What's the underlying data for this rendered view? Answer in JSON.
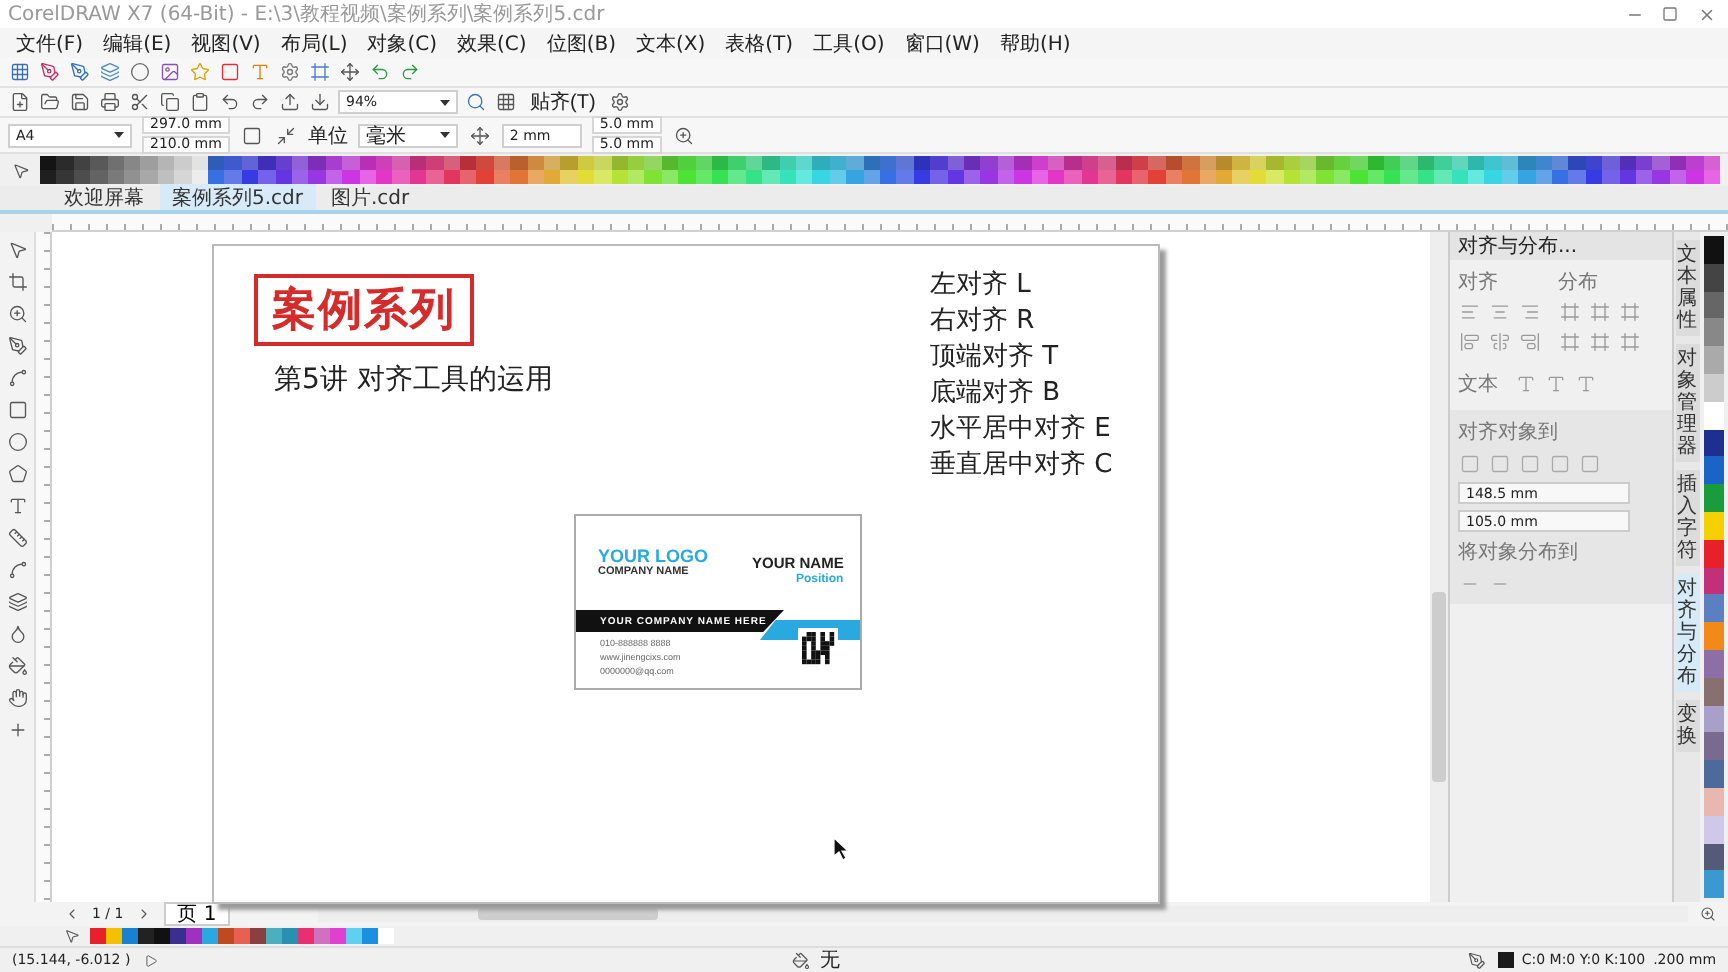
{
  "window": {
    "title": "CorelDRAW X7 (64-Bit) - E:\\3\\教程视频\\案例系列\\案例系列5.cdr"
  },
  "menu": [
    "文件(F)",
    "编辑(E)",
    "视图(V)",
    "布局(L)",
    "对象(C)",
    "效果(C)",
    "位图(B)",
    "文本(X)",
    "表格(T)",
    "工具(O)",
    "窗口(W)",
    "帮助(H)"
  ],
  "standard_toolbar": {
    "zoom": "94%",
    "snap": "贴齐(T)"
  },
  "property_bar": {
    "page_size": "A4",
    "width": "297.0 mm",
    "height": "210.0 mm",
    "units_label": "单位",
    "units": "毫米",
    "nudge": "2 mm",
    "duplicate_x": "5.0 mm",
    "duplicate_y": "5.0 mm"
  },
  "document_tabs": [
    {
      "label": "欢迎屏幕",
      "selected": false
    },
    {
      "label": "案例系列5.cdr",
      "selected": true
    },
    {
      "label": "图片.cdr",
      "selected": false
    }
  ],
  "page": {
    "title": "案例系列",
    "subtitle": "第5讲 对齐工具的运用",
    "alignment_list": [
      "左对齐 L",
      "右对齐 R",
      "顶端对齐 T",
      "底端对齐 B",
      "水平居中对齐 E",
      "垂直居中对齐 C"
    ],
    "business_card": {
      "logo": "YOUR LOGO",
      "company": "COMPANY NAME",
      "name": "YOUR NAME",
      "position": "Position",
      "banner": "YOUR COMPANY NAME HERE",
      "contacts": [
        "010-888888 8888",
        "www.jinengcixs.com",
        "0000000@qq.com"
      ]
    }
  },
  "docker": {
    "title": "对齐与分布...",
    "align_label": "对齐",
    "distribute_label": "分布",
    "text_label": "文本",
    "align_to_label": "对齐对象到",
    "x": "148.5 mm",
    "y": "105.0 mm",
    "distribute_to_label": "将对象分布到"
  },
  "docker_tabs": [
    {
      "label": "文本属性",
      "selected": false
    },
    {
      "label": "对象管理器",
      "selected": false
    },
    {
      "label": "插入字符",
      "selected": false
    },
    {
      "label": "对齐与分布",
      "selected": true
    },
    {
      "label": "变换",
      "selected": false
    }
  ],
  "page_navigator": {
    "count": "1 / 1",
    "page_tab": "页 1"
  },
  "status_bar": {
    "coordinates": "(15.144, -6.012 )",
    "fill": "无",
    "outline": "C:0 M:0 Y:0 K:100",
    "outline_width": ".200 mm"
  }
}
